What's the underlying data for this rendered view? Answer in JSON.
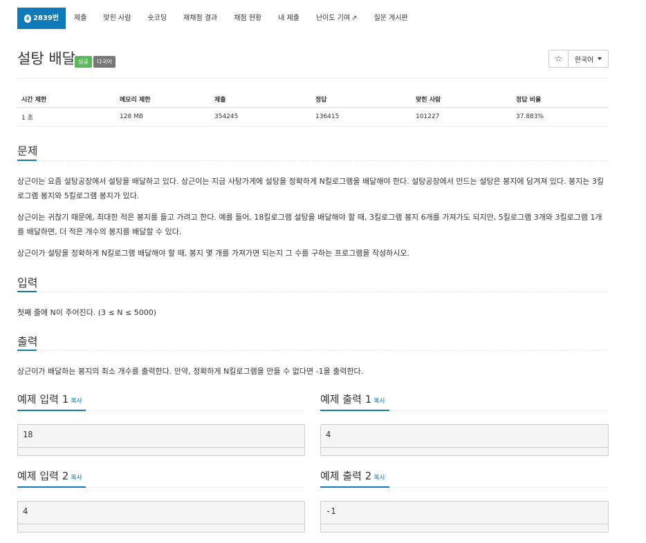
{
  "nav": {
    "problem_id": "2839번",
    "tier_glyph": "4",
    "tabs": [
      "제출",
      "맞힌 사람",
      "숏코딩",
      "재채점 결과",
      "채점 현황",
      "내 제출",
      "난이도 기여",
      "질문 게시판"
    ],
    "external_glyph": "⇗"
  },
  "title": {
    "text": "설탕 배달",
    "badge_success": "성공",
    "badge_multi": "다국어",
    "star_glyph": "☆",
    "language": "한국어"
  },
  "stats": {
    "headers": [
      "시간 제한",
      "메모리 제한",
      "제출",
      "정답",
      "맞힌 사람",
      "정답 비율"
    ],
    "values": [
      "1 초",
      "128 MB",
      "354245",
      "136415",
      "101227",
      "37.883%"
    ]
  },
  "sections": {
    "problem_title": "문제",
    "problem_p1": "상근이는 요즘 설탕공장에서 설탕을 배달하고 있다. 상근이는 지금 사탕가게에 설탕을 정확하게 N킬로그램을 배달해야 한다. 설탕공장에서 만드는 설탕은 봉지에 담겨져 있다. 봉지는 3킬로그램 봉지와 5킬로그램 봉지가 있다.",
    "problem_p2": "상근이는 귀찮기 때문에, 최대한 적은 봉지를 들고 가려고 한다. 예를 들어, 18킬로그램 설탕을 배달해야 할 때, 3킬로그램 봉지 6개를 가져가도 되지만, 5킬로그램 3개와 3킬로그램 1개를 배달하면, 더 적은 개수의 봉지를 배달할 수 있다.",
    "problem_p3": "상근이가 설탕을 정확하게 N킬로그램 배달해야 할 때, 봉지 몇 개를 가져가면 되는지 그 수를 구하는 프로그램을 작성하시오.",
    "input_title": "입력",
    "input_p": "첫째 줄에 N이 주어진다. (3 ≤ N ≤ 5000)",
    "output_title": "출력",
    "output_p": "상근이가 배달하는 봉지의 최소 개수를 출력한다. 만약, 정확하게 N킬로그램을 만들 수 없다면 -1을 출력한다."
  },
  "samples": {
    "copy_label": "복사",
    "in1_title": "예제 입력 1",
    "out1_title": "예제 출력 1",
    "in2_title": "예제 입력 2",
    "out2_title": "예제 출력 2",
    "in1": "18",
    "out1": "4",
    "in2": "4",
    "out2": "-1"
  },
  "colors": {
    "accent": "#0f7ab7",
    "success": "#5cb85c",
    "muted": "#777777"
  }
}
